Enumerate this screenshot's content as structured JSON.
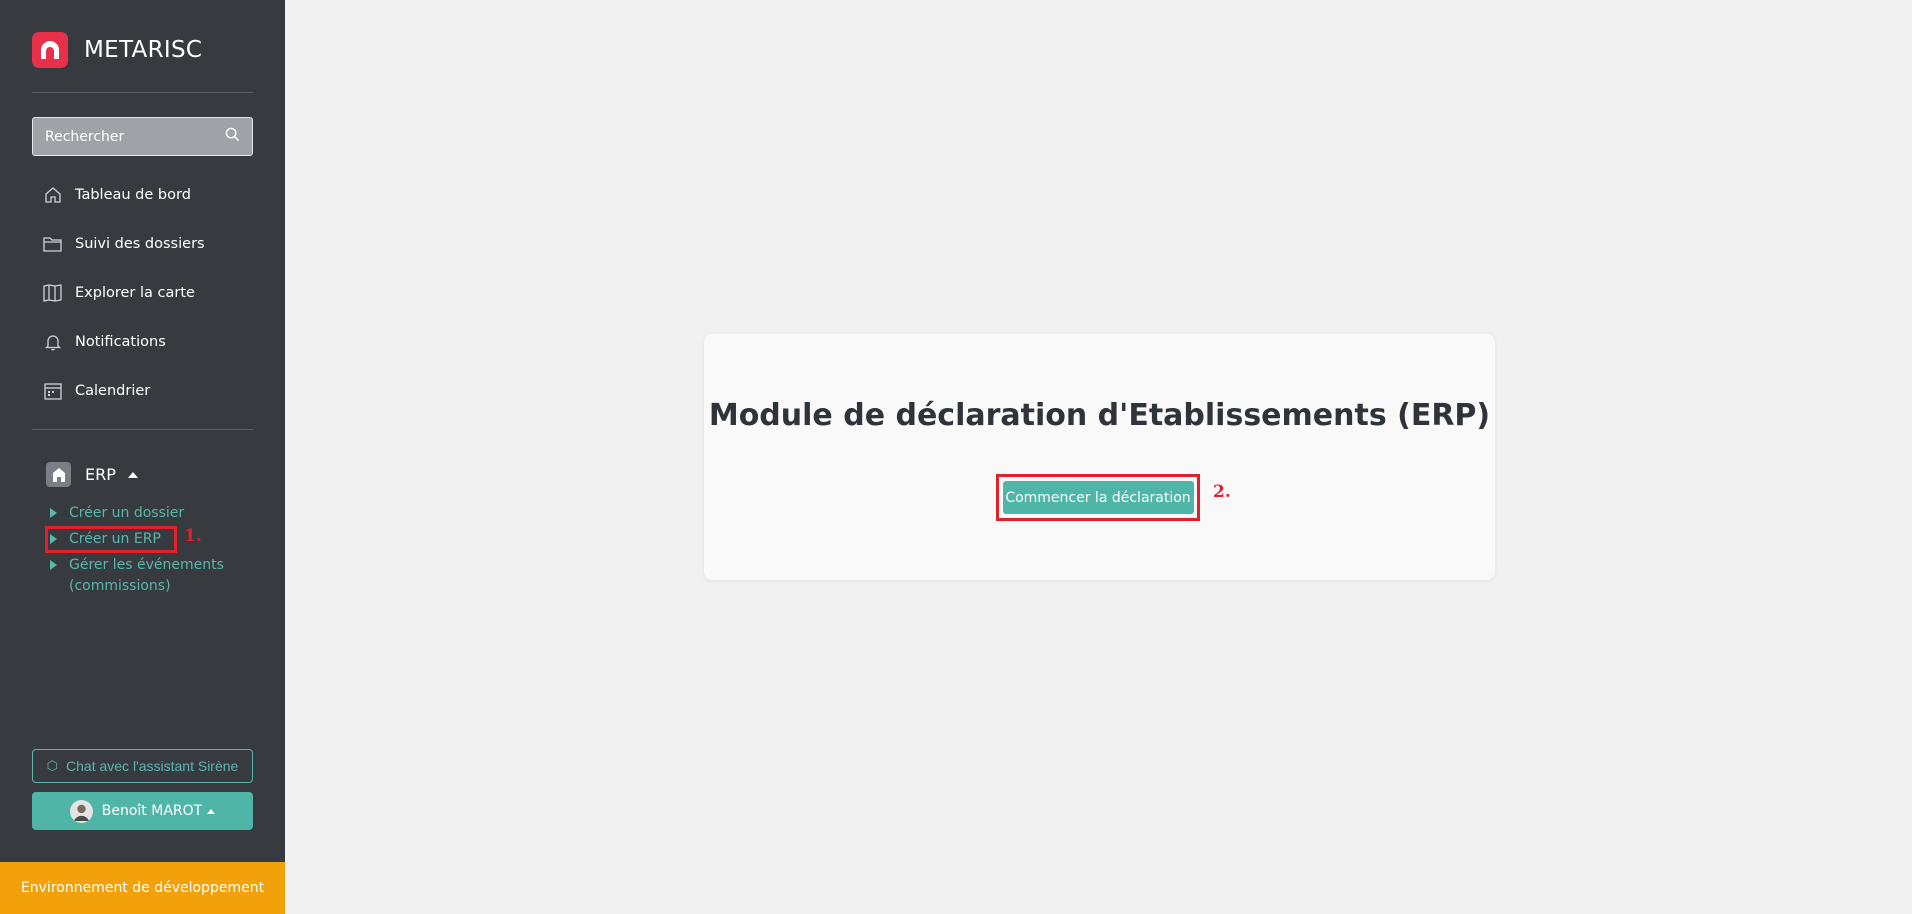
{
  "brand": {
    "name": "METARISC",
    "color": "#e8304a"
  },
  "search": {
    "placeholder": "Rechercher",
    "icon": "search-icon"
  },
  "nav": [
    {
      "label": "Tableau de bord",
      "icon": "home-icon"
    },
    {
      "label": "Suivi des dossiers",
      "icon": "folder-icon"
    },
    {
      "label": "Explorer la carte",
      "icon": "map-icon"
    },
    {
      "label": "Notifications",
      "icon": "bell-icon"
    },
    {
      "label": "Calendrier",
      "icon": "calendar-icon"
    }
  ],
  "erp_section": {
    "label": "ERP",
    "items": [
      {
        "label": "Créer un dossier"
      },
      {
        "label": "Créer un ERP"
      },
      {
        "label": "Gérer les événements (commissions)"
      }
    ]
  },
  "annotations": {
    "step1": "1.",
    "step2": "2."
  },
  "chat_button": {
    "label": "Chat avec l'assistant Sirène"
  },
  "user": {
    "name": "Benoît MAROT"
  },
  "environment": {
    "label": "Environnement de développement",
    "color": "#f2a10b"
  },
  "main": {
    "title": "Module de déclaration d'Etablissements (ERP)",
    "start_button": "Commencer la déclaration"
  },
  "colors": {
    "accent": "#4eb5a7",
    "sidebar": "#373b40",
    "annotation": "#e2202b"
  }
}
